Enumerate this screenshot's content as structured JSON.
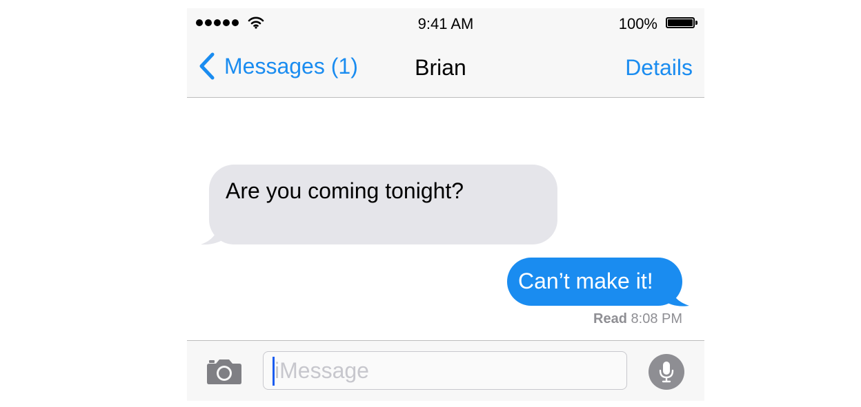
{
  "status_bar": {
    "time": "9:41 AM",
    "battery_percent": "100%",
    "signal_icon": "signal-dots-icon",
    "wifi_icon": "wifi-icon",
    "battery_icon": "battery-icon"
  },
  "nav": {
    "back_label": "Messages (1)",
    "back_icon": "chevron-left-icon",
    "title": "Brian",
    "details_label": "Details"
  },
  "messages": [
    {
      "direction": "incoming",
      "text": "Are you coming tonight?"
    },
    {
      "direction": "outgoing",
      "text": "Can’t make it!"
    }
  ],
  "receipt": {
    "status": "Read",
    "time": "8:08 PM"
  },
  "compose": {
    "camera_icon": "camera-icon",
    "placeholder": "iMessage",
    "value": "",
    "mic_icon": "microphone-icon"
  },
  "colors": {
    "accent": "#1a8cf0",
    "incoming_bubble": "#e5e5ea",
    "outgoing_bubble": "#1a8cf0",
    "bar_background": "#f7f7f7",
    "secondary_text": "#8e8e93"
  }
}
